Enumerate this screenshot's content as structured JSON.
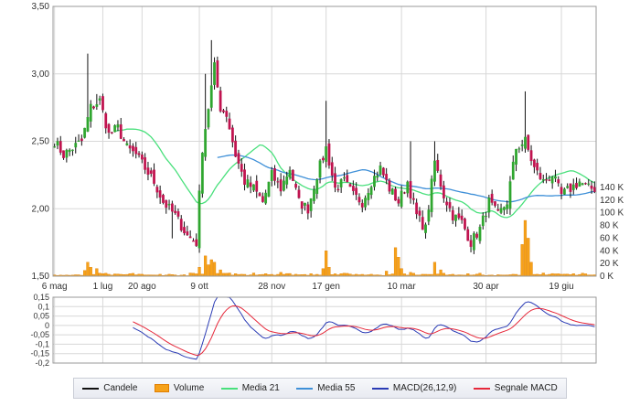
{
  "colors": {
    "up": "#2fa62f",
    "down": "#c0134f",
    "wick": "#111111",
    "volume_fill": "#f6a21a",
    "volume_stroke": "#e07e00",
    "ma21": "#49e07c",
    "ma55": "#3f90d8",
    "macd": "#2a3bb5",
    "signal": "#e6283a",
    "grid": "#d8d8d8",
    "axis_text": "#333333",
    "legend_text": "#222222"
  },
  "legend": [
    {
      "label": "Candele",
      "kind": "line",
      "color": "#111111"
    },
    {
      "label": "Volume",
      "kind": "box",
      "color": "#f6a21a"
    },
    {
      "label": "Media 21",
      "kind": "line",
      "color": "#49e07c"
    },
    {
      "label": "Media 55",
      "kind": "line",
      "color": "#3f90d8"
    },
    {
      "label": "MACD(26,12,9)",
      "kind": "line",
      "color": "#2a3bb5"
    },
    {
      "label": "Segnale MACD",
      "kind": "line",
      "color": "#e6283a"
    }
  ],
  "chart_data": {
    "type": "candlestick",
    "x_tick_labels": [
      {
        "label": "6 mag",
        "i": 0
      },
      {
        "label": "1 lug",
        "i": 16
      },
      {
        "label": "20 ago",
        "i": 29
      },
      {
        "label": "9 ott",
        "i": 48
      },
      {
        "label": "28 nov",
        "i": 72
      },
      {
        "label": "17 gen",
        "i": 90
      },
      {
        "label": "10 mar",
        "i": 115
      },
      {
        "label": "30 apr",
        "i": 143
      },
      {
        "label": "19 giu",
        "i": 168
      }
    ],
    "price_axis": {
      "ticks": [
        "1,50",
        "2,00",
        "2,50",
        "3,00",
        "3,50"
      ],
      "ylim": [
        1.5,
        3.5
      ]
    },
    "volume_axis": {
      "ticks": [
        "0 K",
        "20 K",
        "40 K",
        "60 K",
        "80 K",
        "100 K",
        "120 K",
        "140 K"
      ],
      "ylim": [
        0,
        140000
      ]
    },
    "macd_axis": {
      "ticks": [
        "0,15",
        "0,1",
        "0,05",
        "0",
        "-0,05",
        "-0,1",
        "-0,15",
        "-0,2"
      ],
      "ylim": [
        -0.2,
        0.15
      ]
    },
    "anchors": [
      [
        0,
        2.5
      ],
      [
        3,
        2.4
      ],
      [
        6,
        2.45
      ],
      [
        9,
        2.5
      ],
      [
        12,
        2.75
      ],
      [
        15,
        2.8
      ],
      [
        18,
        2.55
      ],
      [
        21,
        2.6
      ],
      [
        24,
        2.45
      ],
      [
        27,
        2.4
      ],
      [
        30,
        2.3
      ],
      [
        33,
        2.2
      ],
      [
        36,
        2.05
      ],
      [
        40,
        1.95
      ],
      [
        44,
        1.8
      ],
      [
        47,
        1.75
      ],
      [
        49,
        2.45
      ],
      [
        51,
        2.75
      ],
      [
        53,
        3.05
      ],
      [
        55,
        2.75
      ],
      [
        57,
        2.7
      ],
      [
        60,
        2.4
      ],
      [
        63,
        2.2
      ],
      [
        66,
        2.15
      ],
      [
        69,
        2.05
      ],
      [
        72,
        2.25
      ],
      [
        75,
        2.15
      ],
      [
        78,
        2.3
      ],
      [
        81,
        2.05
      ],
      [
        84,
        2.0
      ],
      [
        87,
        2.25
      ],
      [
        90,
        2.45
      ],
      [
        93,
        2.15
      ],
      [
        96,
        2.2
      ],
      [
        99,
        2.1
      ],
      [
        102,
        2.05
      ],
      [
        105,
        2.2
      ],
      [
        108,
        2.3
      ],
      [
        111,
        2.15
      ],
      [
        114,
        2.05
      ],
      [
        117,
        2.2
      ],
      [
        120,
        1.95
      ],
      [
        123,
        1.85
      ],
      [
        126,
        2.35
      ],
      [
        129,
        2.1
      ],
      [
        132,
        1.95
      ],
      [
        135,
        1.9
      ],
      [
        138,
        1.75
      ],
      [
        141,
        1.85
      ],
      [
        144,
        2.05
      ],
      [
        147,
        1.95
      ],
      [
        150,
        2.05
      ],
      [
        153,
        2.45
      ],
      [
        156,
        2.5
      ],
      [
        159,
        2.3
      ],
      [
        162,
        2.2
      ],
      [
        165,
        2.25
      ],
      [
        168,
        2.1
      ],
      [
        171,
        2.15
      ],
      [
        174,
        2.2
      ],
      [
        177,
        2.15
      ]
    ],
    "spikes": [
      {
        "i": 11,
        "high": 3.15
      },
      {
        "i": 14,
        "high": 2.85
      },
      {
        "i": 52,
        "high": 3.25
      },
      {
        "i": 50,
        "high": 3.0
      },
      {
        "i": 90,
        "high": 2.8
      },
      {
        "i": 126,
        "high": 2.5
      },
      {
        "i": 156,
        "high": 2.87
      },
      {
        "i": 118,
        "high": 2.5
      },
      {
        "i": 39,
        "low": 1.78
      }
    ],
    "volume_profile": [
      [
        0,
        2000
      ],
      [
        10,
        9000
      ],
      [
        11,
        22000
      ],
      [
        12,
        14000
      ],
      [
        14,
        12000
      ],
      [
        18,
        3000
      ],
      [
        25,
        4000
      ],
      [
        30,
        2000
      ],
      [
        35,
        3000
      ],
      [
        40,
        2000
      ],
      [
        45,
        5000
      ],
      [
        48,
        14000
      ],
      [
        50,
        32000
      ],
      [
        51,
        18000
      ],
      [
        52,
        26000
      ],
      [
        53,
        22000
      ],
      [
        55,
        10000
      ],
      [
        58,
        5000
      ],
      [
        62,
        3000
      ],
      [
        66,
        5000
      ],
      [
        70,
        4000
      ],
      [
        75,
        6000
      ],
      [
        80,
        3000
      ],
      [
        85,
        4000
      ],
      [
        89,
        12000
      ],
      [
        90,
        40000
      ],
      [
        91,
        14000
      ],
      [
        95,
        4000
      ],
      [
        100,
        3000
      ],
      [
        105,
        3000
      ],
      [
        110,
        8000
      ],
      [
        113,
        45000
      ],
      [
        114,
        30000
      ],
      [
        115,
        12000
      ],
      [
        118,
        6000
      ],
      [
        122,
        3000
      ],
      [
        126,
        22000
      ],
      [
        128,
        10000
      ],
      [
        132,
        3000
      ],
      [
        137,
        4000
      ],
      [
        142,
        2000
      ],
      [
        148,
        2000
      ],
      [
        152,
        3000
      ],
      [
        155,
        50000
      ],
      [
        156,
        88000
      ],
      [
        157,
        60000
      ],
      [
        158,
        22000
      ],
      [
        162,
        5000
      ],
      [
        168,
        3000
      ],
      [
        172,
        4000
      ],
      [
        177,
        2000
      ]
    ]
  }
}
